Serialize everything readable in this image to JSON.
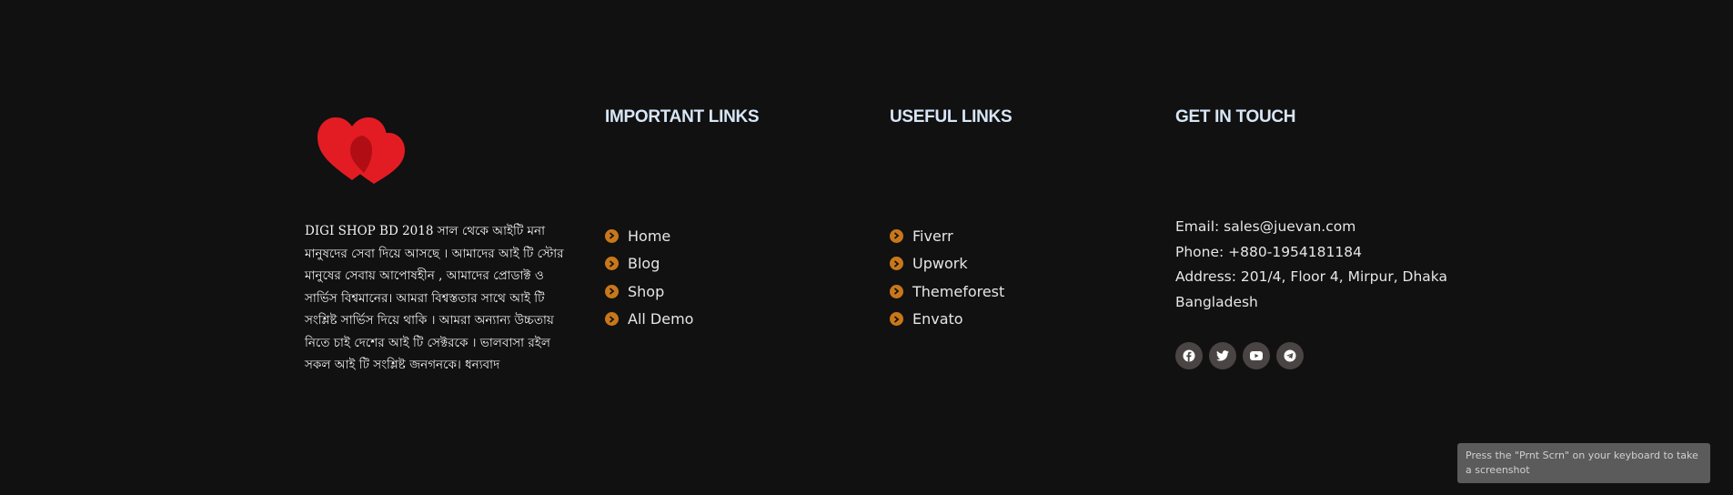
{
  "brand": {
    "logo_icon": "hearts-logo",
    "about_text": "DIGI SHOP BD 2018 সাল থেকে আইটি মনা মানুষদের সেবা দিয়ে আসছে । আমাদের আই টি স্টোর মানুষের সেবায় আপোষহীন , আমাদের প্রোডাক্ট ও সার্ভিস বিশ্বমানের। আমরা বিশ্বস্ততার সাথে আই টি সংশ্লিষ্ট সার্ভিস দিয়ে থাকি । আমরা অন্যান্য উচ্চতায় নিতে চাই দেশের আই টি সেক্টরকে । ভালবাসা রইল সকল আই টি সংশ্লিষ্ট জনগনকে। ধন্যবাদ"
  },
  "important_links": {
    "heading": "IMPORTANT LINKS",
    "items": [
      {
        "label": "Home"
      },
      {
        "label": "Blog"
      },
      {
        "label": "Shop"
      },
      {
        "label": "All Demo"
      }
    ]
  },
  "useful_links": {
    "heading": "USEFUL LINKS",
    "items": [
      {
        "label": "Fiverr"
      },
      {
        "label": "Upwork"
      },
      {
        "label": "Themeforest"
      },
      {
        "label": "Envato"
      }
    ]
  },
  "contact": {
    "heading": "GET IN TOUCH",
    "email": "Email: sales@juevan.com",
    "phone": "Phone: +880-1954181184",
    "address": "Address: 201/4, Floor 4, Mirpur, Dhaka Bangladesh",
    "social": [
      {
        "icon": "facebook-icon"
      },
      {
        "icon": "twitter-icon"
      },
      {
        "icon": "youtube-icon"
      },
      {
        "icon": "telegram-icon"
      }
    ]
  },
  "toast": {
    "text": "Press the \"Prnt Scrn\" on your keyboard to take a screenshot"
  },
  "colors": {
    "background": "#111111",
    "heading": "#d8e6f7",
    "bullet": "#c8771a",
    "social_bg": "#4a4444",
    "heart": "#e31c24",
    "heart_overlap": "#b10d14"
  }
}
